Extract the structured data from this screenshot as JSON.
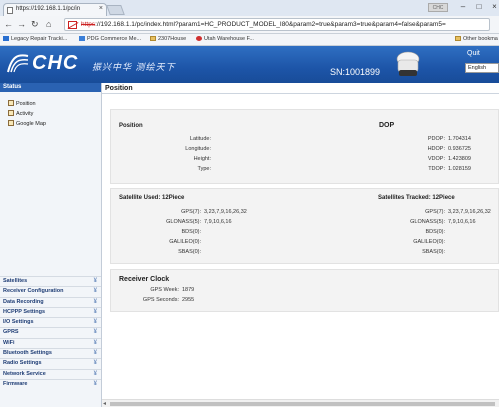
{
  "browser": {
    "tab_title": "https://192.168.1.1/pc/in",
    "url_https": "https",
    "url_rest": "://192.168.1.1/pc/index.html?param1=HC_PRODUCT_MODEL_I80&param2=true&param3=true&param4=false&param5=",
    "user_badge": "CHC",
    "bookmarks": [
      "Legacy Repair Tracki...",
      "PDG Commerce Me...",
      "2307House",
      "Utah Warehouse F..."
    ],
    "other_bookmarks": "Other bookma"
  },
  "header": {
    "brand": "CHC",
    "slogan": "振兴中华 测绘天下",
    "serial": "SN:1001899",
    "quit": "Quit",
    "language": "English"
  },
  "sidebar": {
    "heading": "Status",
    "items": [
      "Position",
      "Activity",
      "Google Map"
    ],
    "categories": [
      "Satellites",
      "Receiver Configuration",
      "Data Recording",
      "HCPPP Settings",
      "I/O Settings",
      "GPRS",
      "WiFi",
      "Bluetooth Settings",
      "Radio Settings",
      "Network Service",
      "Firmware"
    ]
  },
  "main": {
    "title": "Position",
    "position": {
      "heading": "Position",
      "labels": [
        "Latitude:",
        "Longitude:",
        "Height:",
        "Type:"
      ],
      "values": [
        "",
        "",
        "",
        ""
      ]
    },
    "dop": {
      "heading": "DOP",
      "labels": [
        "PDOP:",
        "HDOP:",
        "VDOP:",
        "TDOP:"
      ],
      "values": [
        "1.704314",
        "0.936725",
        "1.423809",
        "1.028159"
      ]
    },
    "sat_used": {
      "heading": "Satellite Used:  12Piece",
      "labels": [
        "GPS(7):",
        "GLONASS(5):",
        "BDS(0):",
        "GALILEO(0):",
        "SBAS(0):"
      ],
      "values": [
        "3,23,7,9,16,26,32",
        "7,9,10,6,16",
        "",
        "",
        ""
      ]
    },
    "sat_tracked": {
      "heading": "Satellites Tracked:  12Piece",
      "labels": [
        "GPS(7):",
        "GLONASS(5):",
        "BDS(0):",
        "GALILEO(0):",
        "SBAS(0):"
      ],
      "values": [
        "3,23,7,9,16,26,32",
        "7,9,10,6,16",
        "",
        "",
        ""
      ]
    },
    "clock": {
      "heading": "Receiver Clock",
      "labels": [
        "GPS Week:",
        "GPS Seconds:"
      ],
      "values": [
        "1879",
        "2955"
      ]
    }
  }
}
